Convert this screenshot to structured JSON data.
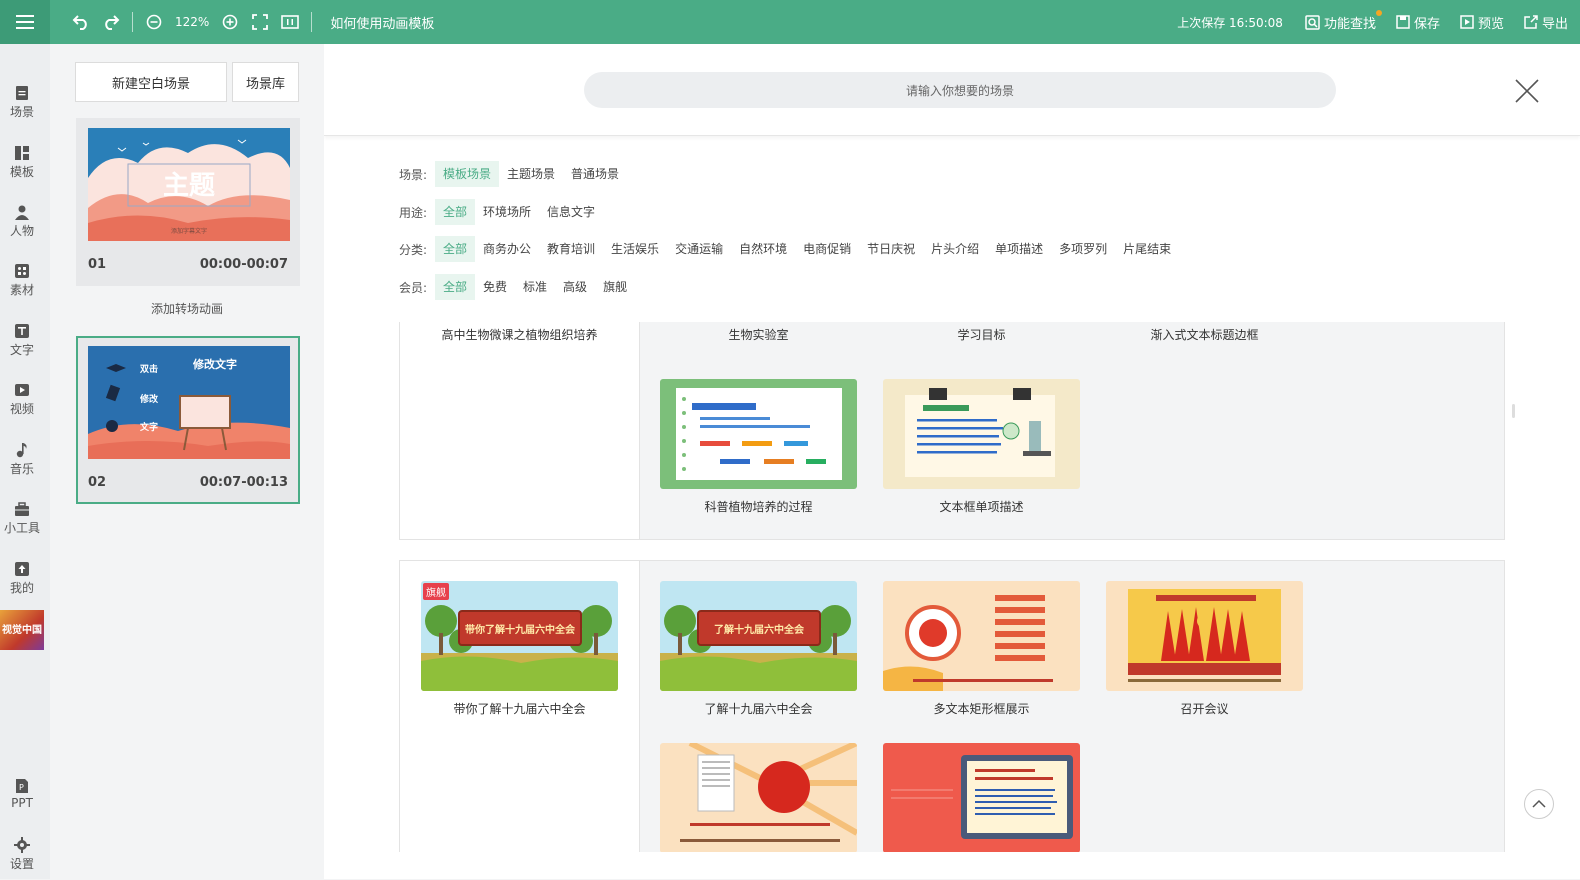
{
  "topbar": {
    "zoom": "122%",
    "doc_title": "如何使用动画模板",
    "last_saved": "上次保存 16:50:08",
    "feature_search": "功能查找",
    "save": "保存",
    "preview": "预览",
    "export": "导出"
  },
  "leftnav": {
    "items": [
      "场景",
      "模板",
      "人物",
      "素材",
      "文字",
      "视频",
      "音乐",
      "小工具",
      "我的"
    ],
    "brand": "视觉中国",
    "ppt": "PPT",
    "settings": "设置"
  },
  "scene_panel": {
    "new_blank": "新建空白场景",
    "library": "场景库",
    "add_transition": "添加转场动画",
    "scenes": [
      {
        "num": "01",
        "time": "00:00-00:07",
        "title_text": "主题",
        "subtitle_text": "添加字幕文字"
      },
      {
        "num": "02",
        "time": "00:07-00:13",
        "lines": [
          "修改文字",
          "双击",
          "修改",
          "文字"
        ]
      }
    ]
  },
  "search": {
    "placeholder": "请输入你想要的场景"
  },
  "filters": [
    {
      "label": "场景:",
      "options": [
        "模板场景",
        "主题场景",
        "普通场景"
      ],
      "active": 0
    },
    {
      "label": "用途:",
      "options": [
        "全部",
        "环境场所",
        "信息文字"
      ],
      "active": 0
    },
    {
      "label": "分类:",
      "options": [
        "全部",
        "商务办公",
        "教育培训",
        "生活娱乐",
        "交通运输",
        "自然环境",
        "电商促销",
        "节日庆祝",
        "片头介绍",
        "单项描述",
        "多项罗列",
        "片尾结束"
      ],
      "active": 0
    },
    {
      "label": "会员:",
      "options": [
        "全部",
        "免费",
        "标准",
        "高级",
        "旗舰"
      ],
      "active": 0
    }
  ],
  "group1": {
    "main": "高中生物微课之植物组织培养",
    "items": [
      "生物实验室",
      "学习目标",
      "渐入式文本标题边框",
      "科普植物培养的过程",
      "文本框单项描述"
    ]
  },
  "group2": {
    "badge": "旗舰",
    "main": "带你了解十九届六中全会",
    "banner": "带你了解十九届六中全会",
    "items": [
      "了解十九届六中全会",
      "多文本矩形框展示",
      "召开会议"
    ],
    "item_banner": "了解十九届六中全会"
  },
  "colors": {
    "accent": "#4aac86",
    "badge": "#e7414c"
  }
}
